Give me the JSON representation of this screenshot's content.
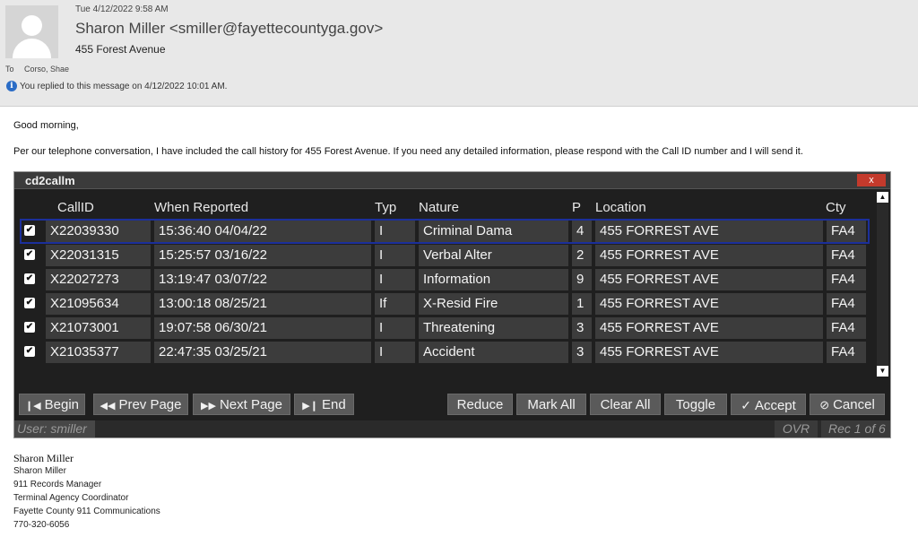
{
  "email": {
    "sent_time": "Tue 4/12/2022 9:58 AM",
    "sender": "Sharon Miller <smiller@fayettecountyga.gov>",
    "subject": "455 Forest Avenue",
    "to_label": "To",
    "to_value": "Corso, Shae",
    "replied_notice": "You replied to this message on 4/12/2022 10:01 AM.",
    "greeting": "Good morning,",
    "intro": "Per our telephone conversation, I have included the call history for 455 Forest Avenue.  If you need any detailed information, please respond with the Call ID number and I will send it."
  },
  "app": {
    "title": "cd2callm",
    "close_label": "x",
    "columns": {
      "callid": "CallID",
      "when": "When Reported",
      "typ": "Typ",
      "nature": "Nature",
      "p": "P",
      "location": "Location",
      "cty": "Cty"
    },
    "rows": [
      {
        "checked": "✔",
        "callid": "X22039330",
        "when": "15:36:40 04/04/22",
        "typ": "I",
        "nature": "Criminal Dama",
        "p": "4",
        "location": "455 FORREST AVE",
        "cty": "FA4"
      },
      {
        "checked": "✔",
        "callid": "X22031315",
        "when": "15:25:57 03/16/22",
        "typ": "I",
        "nature": "Verbal Alter",
        "p": "2",
        "location": "455 FORREST AVE",
        "cty": "FA4"
      },
      {
        "checked": "✔",
        "callid": "X22027273",
        "when": "13:19:47 03/07/22",
        "typ": "I",
        "nature": "Information",
        "p": "9",
        "location": "455 FORREST AVE",
        "cty": "FA4"
      },
      {
        "checked": "✔",
        "callid": "X21095634",
        "when": "13:00:18 08/25/21",
        "typ": "If",
        "nature": "X-Resid Fire",
        "p": "1",
        "location": "455 FORREST AVE",
        "cty": "FA4"
      },
      {
        "checked": "✔",
        "callid": "X21073001",
        "when": "19:07:58 06/30/21",
        "typ": "I",
        "nature": "Threatening",
        "p": "3",
        "location": "455 FORREST AVE",
        "cty": "FA4"
      },
      {
        "checked": "✔",
        "callid": "X21035377",
        "when": "22:47:35 03/25/21",
        "typ": "I",
        "nature": "Accident",
        "p": "3",
        "location": "455 FORREST AVE",
        "cty": "FA4"
      }
    ],
    "buttons": {
      "begin": "Begin",
      "prev_page": "Prev Page",
      "next_page": "Next Page",
      "end": "End",
      "reduce": "Reduce",
      "mark_all": "Mark All",
      "clear_all": "Clear All",
      "toggle": "Toggle",
      "accept": "Accept",
      "cancel": "Cancel"
    },
    "status": {
      "user": "User: smiller",
      "mode": "OVR",
      "record": "Rec 1 of 6"
    }
  },
  "signature": {
    "name": "Sharon Miller",
    "lines": [
      "Sharon Miller",
      "911 Records Manager",
      "Terminal Agency Coordinator",
      "Fayette County 911 Communications",
      "770-320-6056"
    ]
  }
}
